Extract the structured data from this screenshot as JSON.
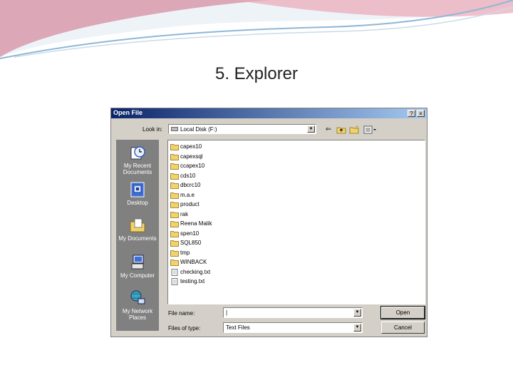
{
  "slide": {
    "title": "5. Explorer"
  },
  "dialog": {
    "title": "Open File",
    "help_label": "?",
    "close_label": "×",
    "look_in_label": "Look in:",
    "look_in_value": "Local Disk (F:)",
    "places": [
      {
        "label": "My Recent Documents",
        "icon": "recent-documents-icon"
      },
      {
        "label": "Desktop",
        "icon": "desktop-icon"
      },
      {
        "label": "My Documents",
        "icon": "my-documents-icon"
      },
      {
        "label": "My Computer",
        "icon": "my-computer-icon"
      },
      {
        "label": "My Network Places",
        "icon": "network-places-icon"
      }
    ],
    "files": [
      {
        "name": "capex10",
        "type": "folder"
      },
      {
        "name": "capexsql",
        "type": "folder"
      },
      {
        "name": "ccapex10",
        "type": "folder"
      },
      {
        "name": "cds10",
        "type": "folder"
      },
      {
        "name": "dbcrc10",
        "type": "folder"
      },
      {
        "name": "m.a.e",
        "type": "folder"
      },
      {
        "name": "product",
        "type": "folder"
      },
      {
        "name": "rak",
        "type": "folder"
      },
      {
        "name": "Reena Malik",
        "type": "folder"
      },
      {
        "name": "spen10",
        "type": "folder"
      },
      {
        "name": "SQL850",
        "type": "folder"
      },
      {
        "name": "tmp",
        "type": "folder"
      },
      {
        "name": "WINBACK",
        "type": "folder"
      },
      {
        "name": "checking.txt",
        "type": "text-file"
      },
      {
        "name": "testing.txt",
        "type": "text-file"
      }
    ],
    "file_name_label": "File name:",
    "file_name_value": "|",
    "files_of_type_label": "Files of type:",
    "files_of_type_value": "Text Files",
    "open_label": "Open",
    "cancel_label": "Cancel"
  },
  "colors": {
    "titlebar_start": "#0a246a",
    "titlebar_end": "#a6caf0",
    "dialog_bg": "#d4d0c8",
    "places_bg": "#808080",
    "folder": "#f2d36b"
  }
}
